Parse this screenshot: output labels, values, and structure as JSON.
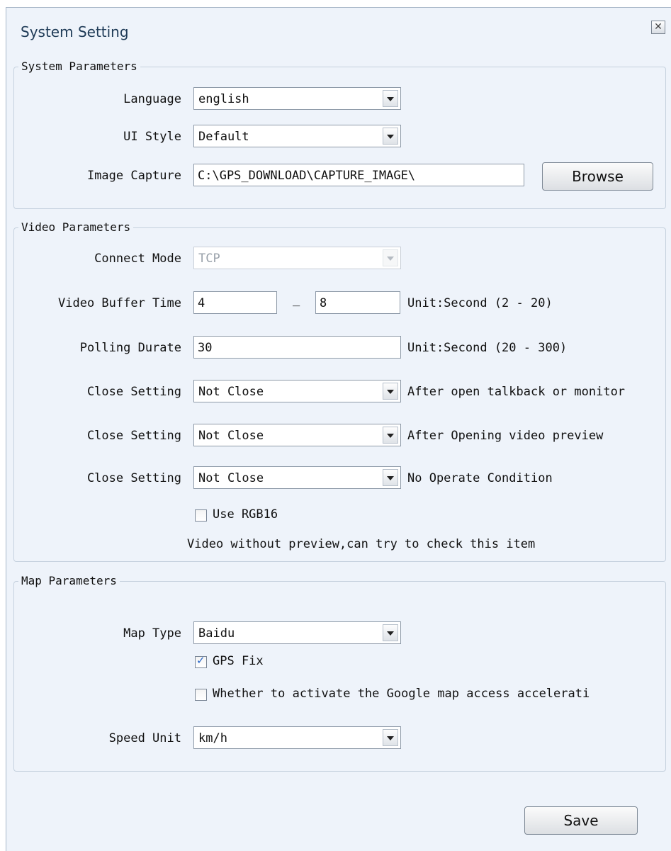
{
  "window": {
    "title": "System Setting",
    "close_label": "✕"
  },
  "system": {
    "legend": "System Parameters",
    "language_label": "Language",
    "language_value": "english",
    "ui_style_label": "UI Style",
    "ui_style_value": "Default",
    "image_capture_label": "Image Capture",
    "image_capture_value": "C:\\GPS_DOWNLOAD\\CAPTURE_IMAGE\\",
    "browse_label": "Browse"
  },
  "video": {
    "legend": "Video Parameters",
    "connect_mode_label": "Connect Mode",
    "connect_mode_value": "TCP",
    "buffer_label": "Video Buffer Time",
    "buffer_min": "4",
    "buffer_sep": "_",
    "buffer_max": "8",
    "buffer_unit": "Unit:Second (2 - 20)",
    "polling_label": "Polling Durate",
    "polling_value": "30",
    "polling_unit": "Unit:Second (20 - 300)",
    "close_settings": [
      {
        "label": "Close Setting",
        "value": "Not Close",
        "note": "After open talkback or monitor"
      },
      {
        "label": "Close Setting",
        "value": "Not Close",
        "note": "After Opening video preview"
      },
      {
        "label": "Close Setting",
        "value": "Not Close",
        "note": "No Operate Condition"
      }
    ],
    "rgb16_label": "Use RGB16",
    "rgb16_checked": false,
    "rgb16_hint": "Video without preview,can try to check this item"
  },
  "map": {
    "legend": "Map Parameters",
    "map_type_label": "Map Type",
    "map_type_value": "Baidu",
    "gps_fix_label": "GPS Fix",
    "gps_fix_checked": true,
    "google_accel_label": "Whether to activate the Google map access accelerati",
    "google_accel_checked": false,
    "speed_unit_label": "Speed Unit",
    "speed_unit_value": "km/h"
  },
  "footer": {
    "save_label": "Save"
  }
}
